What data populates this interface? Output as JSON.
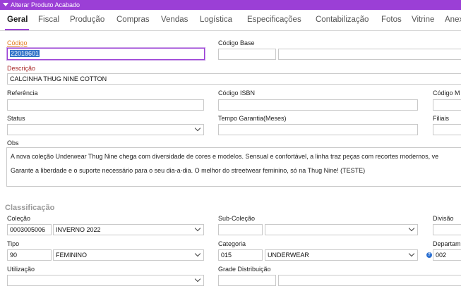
{
  "window": {
    "title": "Alterar Produto Acabado"
  },
  "tabs": [
    "Geral",
    "Fiscal",
    "Produção",
    "Compras",
    "Vendas",
    "Logística",
    "Especificações",
    "Contabilização",
    "Fotos",
    "Vitrine",
    "Anex"
  ],
  "fields": {
    "codigo": {
      "label": "Código",
      "value": "22018601"
    },
    "codigo_base": {
      "label": "Código Base",
      "value": "",
      "value2": ""
    },
    "descricao": {
      "label": "Descrição",
      "value": "CALCINHA THUG NINE COTTON"
    },
    "referencia": {
      "label": "Referência",
      "value": ""
    },
    "codigo_isbn": {
      "label": "Código ISBN",
      "value": ""
    },
    "codigo_m": {
      "label": "Código M",
      "value": ""
    },
    "status": {
      "label": "Status",
      "value": ""
    },
    "tempo_garantia": {
      "label": "Tempo Garantia(Meses)",
      "value": ""
    },
    "filiais": {
      "label": "Filiais",
      "value": ""
    },
    "obs": {
      "label": "Obs",
      "line1": "A nova coleção Underwear Thug Nine chega com  diversidade de cores e modelos. Sensual e confortável, a linha traz peças com recortes modernos, ve",
      "line2": "Garante a liberdade e o suporte necessário para o seu dia-a-dia. O melhor do streetwear feminino, só na Thug Nine! (TESTE)"
    }
  },
  "classificacao": {
    "title": "Classificação",
    "colecao": {
      "label": "Coleção",
      "code": "0003005006",
      "value": "INVERNO 2022"
    },
    "sub_colecao": {
      "label": "Sub-Coleção",
      "code": "",
      "value": ""
    },
    "divisao": {
      "label": "Divisão",
      "value": ""
    },
    "tipo": {
      "label": "Tipo",
      "code": "90",
      "value": "FEMININO"
    },
    "categoria": {
      "label": "Categoria",
      "code": "015",
      "value": "UNDERWEAR"
    },
    "departamento": {
      "label": "Departam",
      "code": "002",
      "help": "?"
    },
    "utilizacao": {
      "label": "Utilização",
      "value": ""
    },
    "grade_distribuicao": {
      "label": "Grade Distribuição",
      "code": "",
      "value": ""
    }
  },
  "colors": {
    "accent": "#9b3fd6",
    "label_required": "#e0781a",
    "label_warn": "#a82a2a",
    "section": "#9a9a9a"
  }
}
